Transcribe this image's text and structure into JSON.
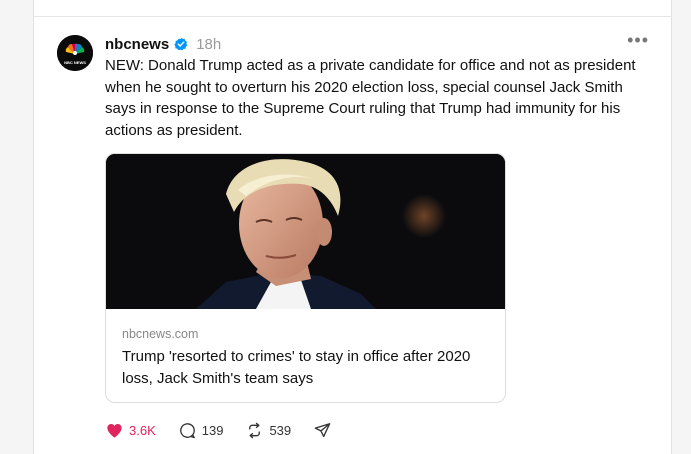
{
  "post": {
    "author": "nbcnews",
    "verified_icon": "verified-badge-icon",
    "time": "18h",
    "more_icon": "more-options-icon",
    "text": "NEW: Donald Trump acted as a private candidate for office and not as president when he sought to overturn his 2020 election loss, special counsel Jack Smith says in response to the Supreme Court ruling that Trump had immunity for his actions as president.",
    "avatar_label": "NBC NEWS",
    "link_card": {
      "image_icon": "article-photo",
      "domain": "nbcnews.com",
      "title": "Trump 'resorted to crimes' to stay in office after 2020 loss, Jack Smith's team says"
    },
    "actions": {
      "likes": "3.6K",
      "replies": "139",
      "reposts": "539",
      "like_color": "#e0245e"
    }
  }
}
